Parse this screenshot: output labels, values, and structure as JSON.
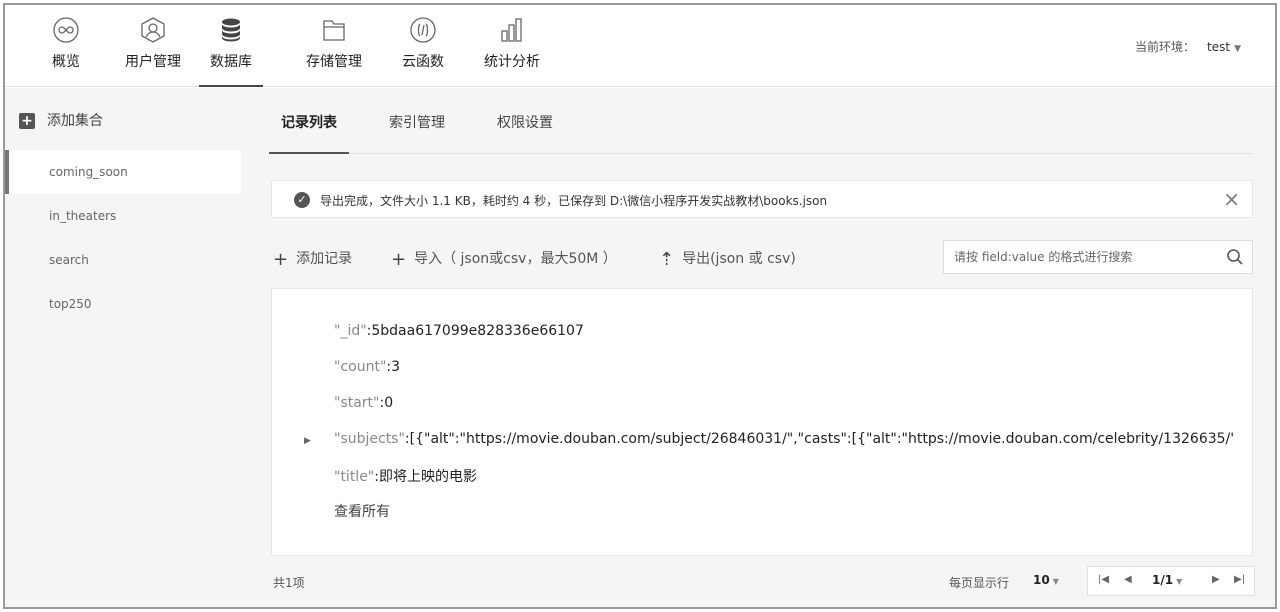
{
  "nav": {
    "items": [
      {
        "label": "概览",
        "icon": "infinity-icon"
      },
      {
        "label": "用户管理",
        "icon": "user-icon"
      },
      {
        "label": "数据库",
        "icon": "database-icon"
      },
      {
        "label": "存储管理",
        "icon": "folder-icon"
      },
      {
        "label": "云函数",
        "icon": "function-icon"
      },
      {
        "label": "统计分析",
        "icon": "chart-icon"
      }
    ],
    "active_index": 2,
    "env_label": "当前环境：",
    "env_value": "test"
  },
  "sidebar": {
    "add_label": "添加集合",
    "collections": [
      "coming_soon",
      "in_theaters",
      "search",
      "top250"
    ],
    "active_index": 0
  },
  "tabs": [
    "记录列表",
    "索引管理",
    "权限设置"
  ],
  "notice": {
    "message": "导出完成，文件大小 1.1 KB，耗时约 4 秒，已保存到 D:\\微信小程序开发实战教材\\books.json"
  },
  "toolbar": {
    "add_record": "添加记录",
    "import": "导入（ json或csv，最大50M ）",
    "export": "导出(json 或 csv)"
  },
  "search": {
    "placeholder": "请按 field:value 的格式进行搜索"
  },
  "record": {
    "fields": [
      {
        "key": "\"_id\"",
        "value": ":5bdaa617099e828336e66107"
      },
      {
        "key": "\"count\"",
        "value": ":3"
      },
      {
        "key": "\"start\"",
        "value": ":0"
      },
      {
        "key": "\"subjects\"",
        "value": ":[{\"alt\":\"https://movie.douban.com/subject/26846031/\",\"casts\":[{\"alt\":\"https://movie.douban.com/celebrity/1326635/\",\"..."
      },
      {
        "key": "\"title\"",
        "value": ":即将上映的电影"
      }
    ],
    "view_all": "查看所有"
  },
  "footer": {
    "count": "共1项",
    "per_page_label": "每页显示行",
    "per_page_value": "10",
    "page": "1/1"
  }
}
